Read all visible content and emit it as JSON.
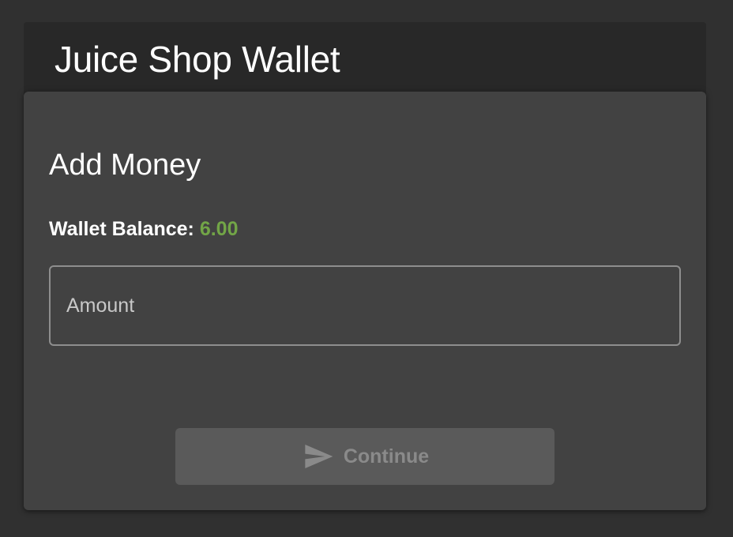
{
  "header": {
    "title": "Juice Shop Wallet"
  },
  "card": {
    "title": "Add Money",
    "balance_label": "Wallet Balance:",
    "balance_value": "6.00"
  },
  "amount_input": {
    "placeholder": "Amount",
    "value": ""
  },
  "continue_button": {
    "label": "Continue",
    "icon": "send-icon",
    "disabled": true
  },
  "colors": {
    "background": "#303030",
    "header_bg": "#282828",
    "card_bg": "#424242",
    "balance_accent": "#72a547",
    "button_bg_disabled": "#5a5a5a",
    "button_text_disabled": "#8a8a8a"
  }
}
